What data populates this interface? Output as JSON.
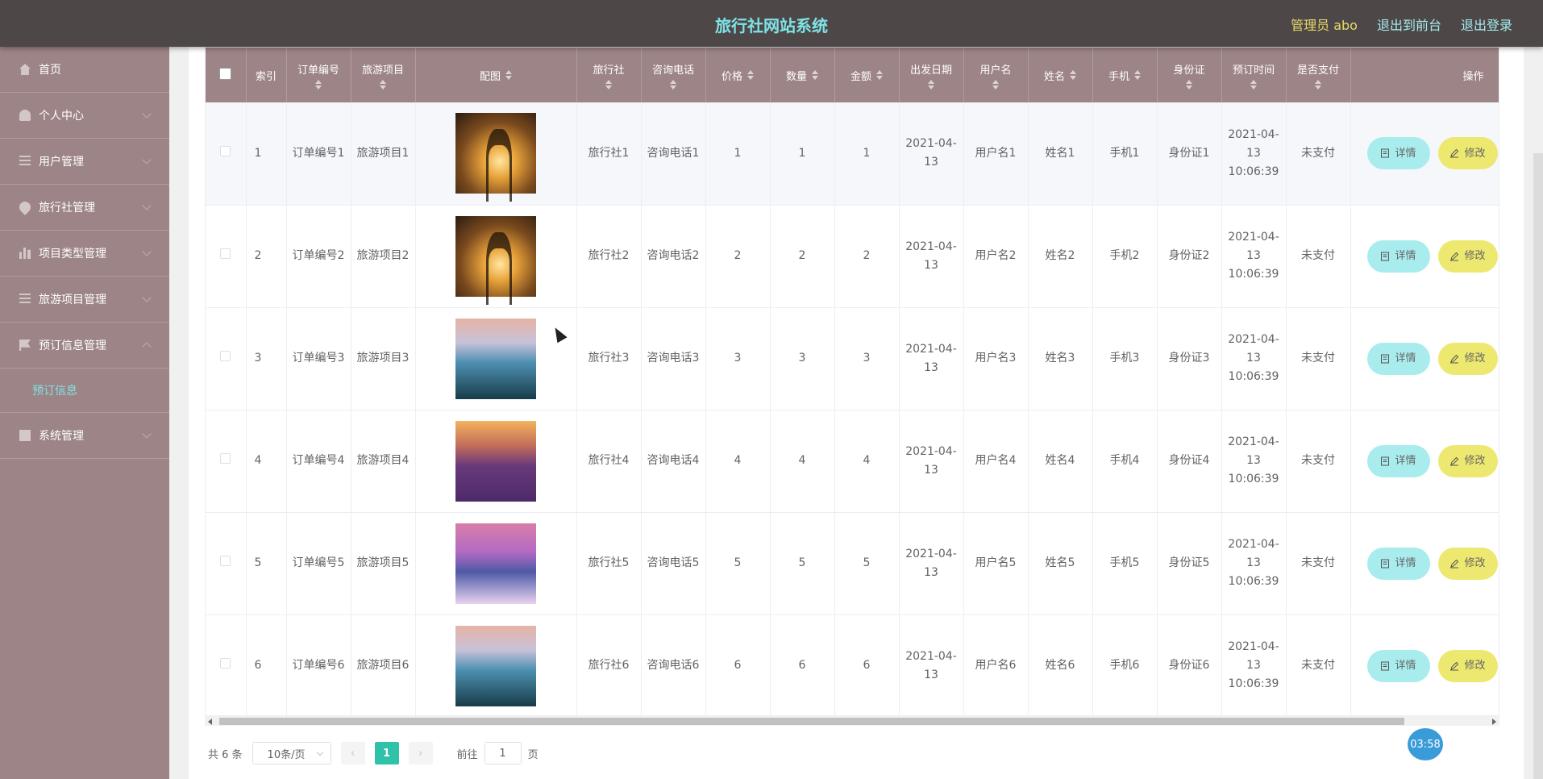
{
  "header": {
    "title": "旅行社网站系统",
    "user_label": "管理员 abo",
    "front_link": "退出到前台",
    "logout_link": "退出登录"
  },
  "sidebar": {
    "items": [
      {
        "label": "首页",
        "icon": "home-icon"
      },
      {
        "label": "个人中心",
        "icon": "user-icon"
      },
      {
        "label": "用户管理",
        "icon": "list-icon"
      },
      {
        "label": "旅行社管理",
        "icon": "location-icon"
      },
      {
        "label": "项目类型管理",
        "icon": "bar-chart-icon"
      },
      {
        "label": "旅游项目管理",
        "icon": "list-icon"
      },
      {
        "label": "预订信息管理",
        "icon": "flag-icon"
      },
      {
        "label": "系统管理",
        "icon": "grid-icon"
      }
    ],
    "active_sub": "预订信息"
  },
  "table": {
    "columns": [
      "索引",
      "订单编号",
      "旅游项目",
      "配图",
      "旅行社",
      "咨询电话",
      "价格",
      "数量",
      "金额",
      "出发日期",
      "用户名",
      "姓名",
      "手机",
      "身份证",
      "预订时间",
      "是否支付",
      "操作"
    ],
    "detail_label": "详情",
    "edit_label": "修改",
    "rows": [
      {
        "index": "1",
        "order_no": "订单编号1",
        "project": "旅游项目1",
        "image": "sunset-tree",
        "agency": "旅行社1",
        "phone": "咨询电话1",
        "price": "1",
        "qty": "1",
        "amount": "1",
        "date": "2021-04-13",
        "username": "用户名1",
        "name": "姓名1",
        "mobile": "手机1",
        "idcard": "身份证1",
        "booked_at": "2021-04-13 10:06:39",
        "paid": "未支付"
      },
      {
        "index": "2",
        "order_no": "订单编号2",
        "project": "旅游项目2",
        "image": "sunset-tree",
        "agency": "旅行社2",
        "phone": "咨询电话2",
        "price": "2",
        "qty": "2",
        "amount": "2",
        "date": "2021-04-13",
        "username": "用户名2",
        "name": "姓名2",
        "mobile": "手机2",
        "idcard": "身份证2",
        "booked_at": "2021-04-13 10:06:39",
        "paid": "未支付"
      },
      {
        "index": "3",
        "order_no": "订单编号3",
        "project": "旅游项目3",
        "image": "lake-castle",
        "agency": "旅行社3",
        "phone": "咨询电话3",
        "price": "3",
        "qty": "3",
        "amount": "3",
        "date": "2021-04-13",
        "username": "用户名3",
        "name": "姓名3",
        "mobile": "手机3",
        "idcard": "身份证3",
        "booked_at": "2021-04-13 10:06:39",
        "paid": "未支付"
      },
      {
        "index": "4",
        "order_no": "订单编号4",
        "project": "旅游项目4",
        "image": "lavender-field",
        "agency": "旅行社4",
        "phone": "咨询电话4",
        "price": "4",
        "qty": "4",
        "amount": "4",
        "date": "2021-04-13",
        "username": "用户名4",
        "name": "姓名4",
        "mobile": "手机4",
        "idcard": "身份证4",
        "booked_at": "2021-04-13 10:06:39",
        "paid": "未支付"
      },
      {
        "index": "5",
        "order_no": "订单编号5",
        "project": "旅游项目5",
        "image": "crater-lake",
        "agency": "旅行社5",
        "phone": "咨询电话5",
        "price": "5",
        "qty": "5",
        "amount": "5",
        "date": "2021-04-13",
        "username": "用户名5",
        "name": "姓名5",
        "mobile": "手机5",
        "idcard": "身份证5",
        "booked_at": "2021-04-13 10:06:39",
        "paid": "未支付"
      },
      {
        "index": "6",
        "order_no": "订单编号6",
        "project": "旅游项目6",
        "image": "lake-castle",
        "agency": "旅行社6",
        "phone": "咨询电话6",
        "price": "6",
        "qty": "6",
        "amount": "6",
        "date": "2021-04-13",
        "username": "用户名6",
        "name": "姓名6",
        "mobile": "手机6",
        "idcard": "身份证6",
        "booked_at": "2021-04-13 10:06:39",
        "paid": "未支付"
      }
    ]
  },
  "pagination": {
    "total": "共 6 条",
    "page_size": "10条/页",
    "current": "1",
    "goto_prefix": "前往",
    "goto_value": "1",
    "goto_suffix": "页"
  },
  "timer": "03:58",
  "colors": {
    "header": "#4d4847",
    "sidebar": "#9d8486",
    "accent": "#7fe3e7",
    "detail_btn": "#a9ecee",
    "edit_btn": "#ede86f",
    "page_active": "#2ec2a8"
  }
}
